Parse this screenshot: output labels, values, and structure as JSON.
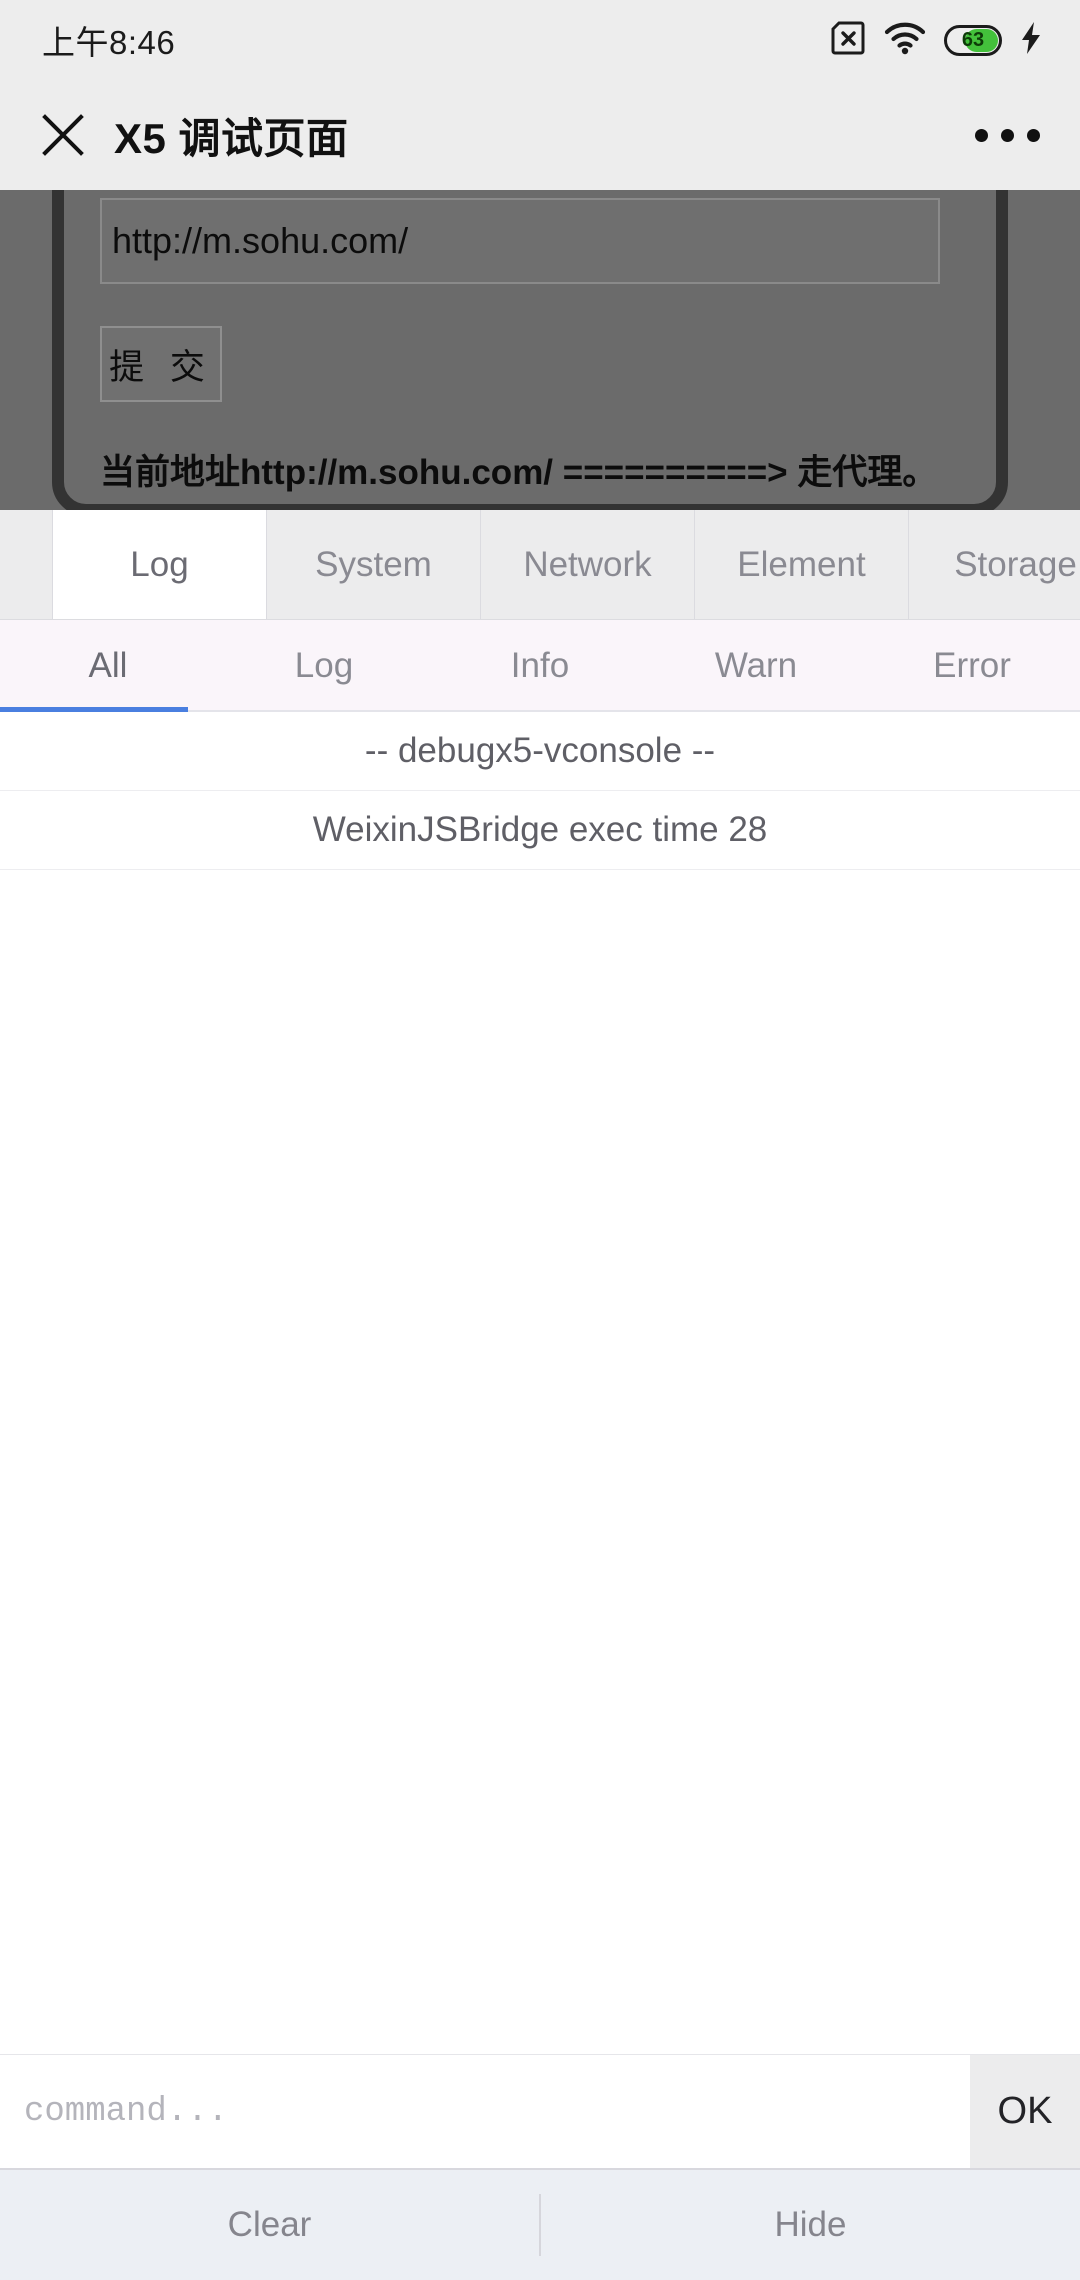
{
  "statusbar": {
    "time": "上午8:46",
    "sim_icon": "sim-card-disabled-icon",
    "wifi_icon": "wifi-icon",
    "battery_percent": "63",
    "battery_level": 63,
    "battery_color": "#43c13b",
    "charging_icon": "lightning-bolt-icon"
  },
  "navbar": {
    "close_icon": "close-icon",
    "title": "X5 调试页面",
    "more_icon": "more-options-icon"
  },
  "webpage": {
    "url_value": "http://m.sohu.com/",
    "submit_label": "提 交",
    "proxy_message": "当前地址http://m.sohu.com/ ==========> 走代理。"
  },
  "console": {
    "tabs": [
      {
        "label": "Log",
        "active": true
      },
      {
        "label": "System",
        "active": false
      },
      {
        "label": "Network",
        "active": false
      },
      {
        "label": "Element",
        "active": false
      },
      {
        "label": "Storage",
        "active": false
      }
    ],
    "filters": [
      {
        "label": "All",
        "active": true
      },
      {
        "label": "Log",
        "active": false
      },
      {
        "label": "Info",
        "active": false
      },
      {
        "label": "Warn",
        "active": false
      },
      {
        "label": "Error",
        "active": false
      }
    ],
    "accent_color": "#4a7fe0",
    "logs": [
      {
        "text": "-- debugx5-vconsole --"
      },
      {
        "text": "WeixinJSBridge exec time 28"
      }
    ],
    "command": {
      "placeholder": "command...",
      "value": "",
      "ok_label": "OK"
    },
    "footer": {
      "clear_label": "Clear",
      "hide_label": "Hide"
    }
  }
}
